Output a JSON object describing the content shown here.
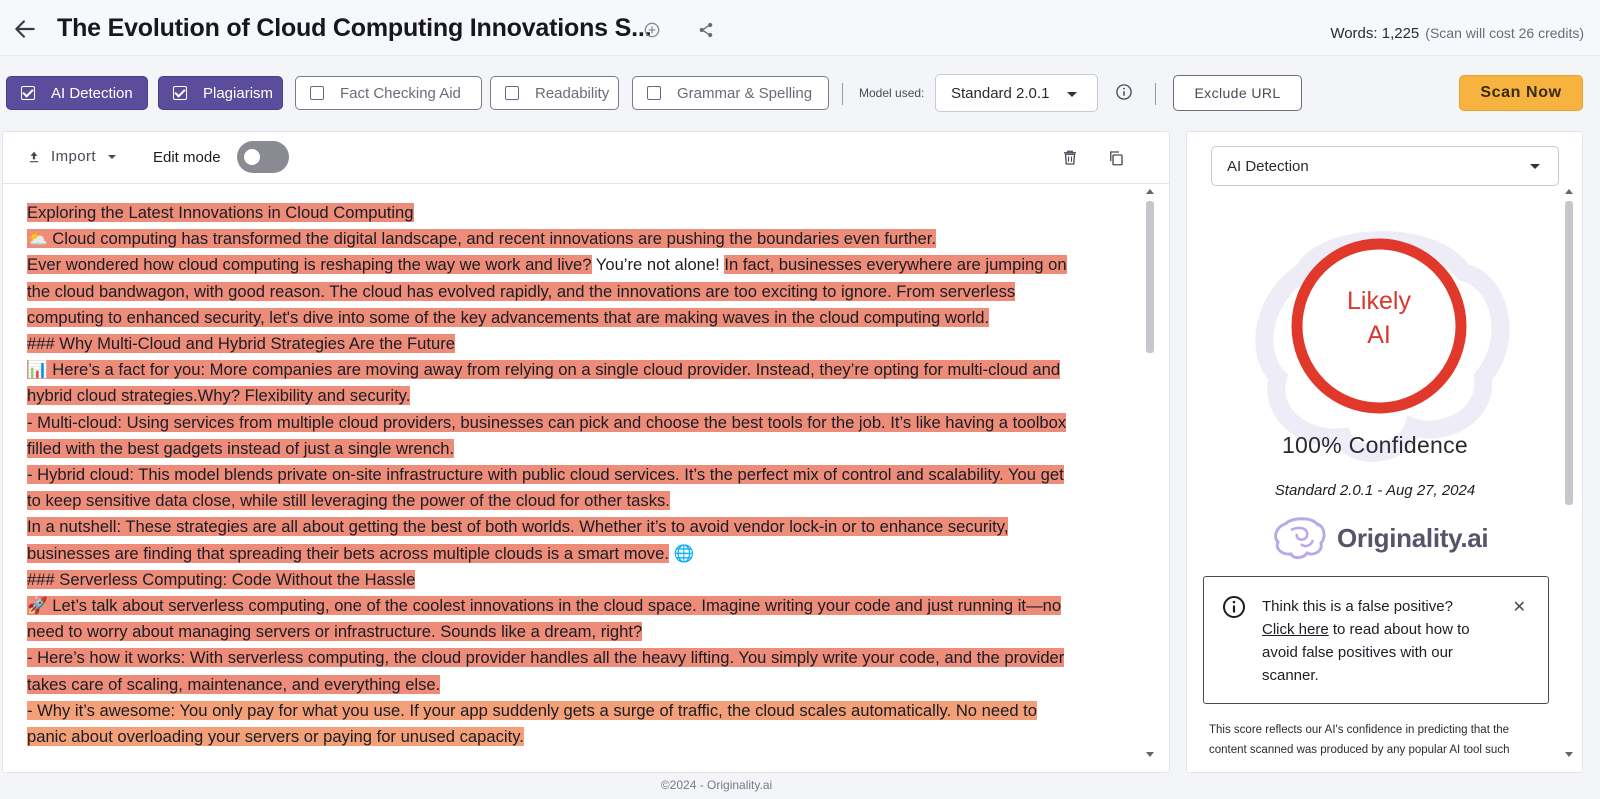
{
  "header": {
    "title": "The Evolution of Cloud Computing Innovations S...",
    "words_label": "Words: 1,225",
    "scan_cost": "(Scan will cost 26 credits)"
  },
  "toolbar": {
    "options": [
      {
        "label": "AI Detection",
        "checked": true
      },
      {
        "label": "Plagiarism",
        "checked": true
      },
      {
        "label": "Fact Checking Aid",
        "checked": false
      },
      {
        "label": "Readability",
        "checked": false
      },
      {
        "label": "Grammar & Spelling",
        "checked": false
      }
    ],
    "model_label": "Model used:",
    "model_value": "Standard 2.0.1",
    "exclude_label": "Exclude URL",
    "scan_label": "Scan Now"
  },
  "editor": {
    "import_label": "Import",
    "edit_mode_label": "Edit mode",
    "edit_mode_on": false
  },
  "text_lines": [
    {
      "segments": [
        {
          "t": "Exploring the Latest Innovations in Cloud Computing",
          "h": "red"
        }
      ]
    },
    {
      "segments": [
        {
          "t": "⛅ Cloud computing has transformed the digital landscape, and recent innovations are pushing the boundaries even further.",
          "h": "red"
        }
      ]
    },
    {
      "segments": [
        {
          "t": "Ever wondered how cloud computing is reshaping the way we work and live?",
          "h": "red"
        },
        {
          "t": " You’re not alone! ",
          "h": ""
        },
        {
          "t": "In fact, businesses everywhere are jumping on",
          "h": "red"
        }
      ]
    },
    {
      "segments": [
        {
          "t": "the cloud bandwagon, with good reason. The cloud has evolved rapidly, and the innovations are too exciting to ignore. From serverless",
          "h": "red"
        }
      ]
    },
    {
      "segments": [
        {
          "t": "computing to enhanced security, let's dive into some of the key advancements that are making waves in the cloud computing world.",
          "h": "red"
        }
      ]
    },
    {
      "segments": [
        {
          "t": "### Why Multi-Cloud and Hybrid Strategies Are the Future",
          "h": "red"
        }
      ]
    },
    {
      "segments": [
        {
          "t": "📊 Here’s a fact for you: More companies are moving away from relying on a single cloud provider. Instead, they’re opting for multi-cloud and",
          "h": "red"
        }
      ]
    },
    {
      "segments": [
        {
          "t": "hybrid cloud strategies.Why? Flexibility and security.",
          "h": "red"
        }
      ]
    },
    {
      "segments": [
        {
          "t": "- Multi-cloud: Using services from multiple cloud providers, businesses can pick and choose the best tools for the job. It’s like having a toolbox",
          "h": "red"
        }
      ]
    },
    {
      "segments": [
        {
          "t": "filled with the best gadgets instead of just a single wrench.",
          "h": "red"
        }
      ]
    },
    {
      "segments": [
        {
          "t": "- Hybrid cloud: This model blends private on-site infrastructure with public cloud services. It’s the perfect mix of control and scalability. You get",
          "h": "red"
        }
      ]
    },
    {
      "segments": [
        {
          "t": "to keep sensitive data close, while still leveraging the power of the cloud for other tasks.",
          "h": "red"
        }
      ]
    },
    {
      "segments": [
        {
          "t": "In a nutshell: These strategies are all about getting the best of both worlds. Whether it’s to avoid vendor lock-in or to enhance security,",
          "h": "red"
        }
      ]
    },
    {
      "segments": [
        {
          "t": "businesses are finding that spreading their bets across multiple clouds is a smart move.",
          "h": "red"
        },
        {
          "t": " 🌐",
          "h": ""
        }
      ]
    },
    {
      "segments": [
        {
          "t": "### Serverless Computing: Code Without the Hassle",
          "h": "red"
        }
      ]
    },
    {
      "segments": [
        {
          "t": "🚀 Let’s talk about serverless computing, one of the coolest innovations in the cloud space. Imagine writing your code and just running it—no",
          "h": "red"
        }
      ]
    },
    {
      "segments": [
        {
          "t": "need to worry about managing servers or infrastructure. Sounds like a dream, right?",
          "h": "red"
        }
      ]
    },
    {
      "segments": [
        {
          "t": "- Here’s how it works: With serverless computing, the cloud provider handles all the heavy lifting. You simply write your code, and the provider",
          "h": "red"
        }
      ]
    },
    {
      "segments": [
        {
          "t": "takes care of scaling, maintenance, and everything else.",
          "h": "red"
        }
      ]
    },
    {
      "segments": [
        {
          "t": "- Why it’s awesome: You only pay for what you use. If your app suddenly gets a surge of traffic, the cloud scales automatically. No need to",
          "h": "orange"
        }
      ]
    },
    {
      "segments": [
        {
          "t": "panic about overloading your servers or paying for unused capacity.",
          "h": "orange"
        }
      ]
    }
  ],
  "results": {
    "selector_value": "AI Detection",
    "verdict_line1": "Likely",
    "verdict_line2": "AI",
    "confidence": "100% Confidence",
    "model_date": "Standard 2.0.1 - Aug 27, 2024",
    "brand": "Originality.ai",
    "fp_line1": "Think this is a false positive?",
    "fp_link": "Click here",
    "fp_rest": " to read about how to avoid false positives with our scanner.",
    "score_note": "This score reflects our AI's confidence in predicting that the content scanned was produced by any popular AI tool such"
  },
  "footer": "©2024 - Originality.ai",
  "colors": {
    "accent": "#5b4d9b",
    "scan": "#f6b33f",
    "highlight_red": "#ed8c79",
    "highlight_orange": "#f3a079",
    "ring": "#e0392b"
  }
}
